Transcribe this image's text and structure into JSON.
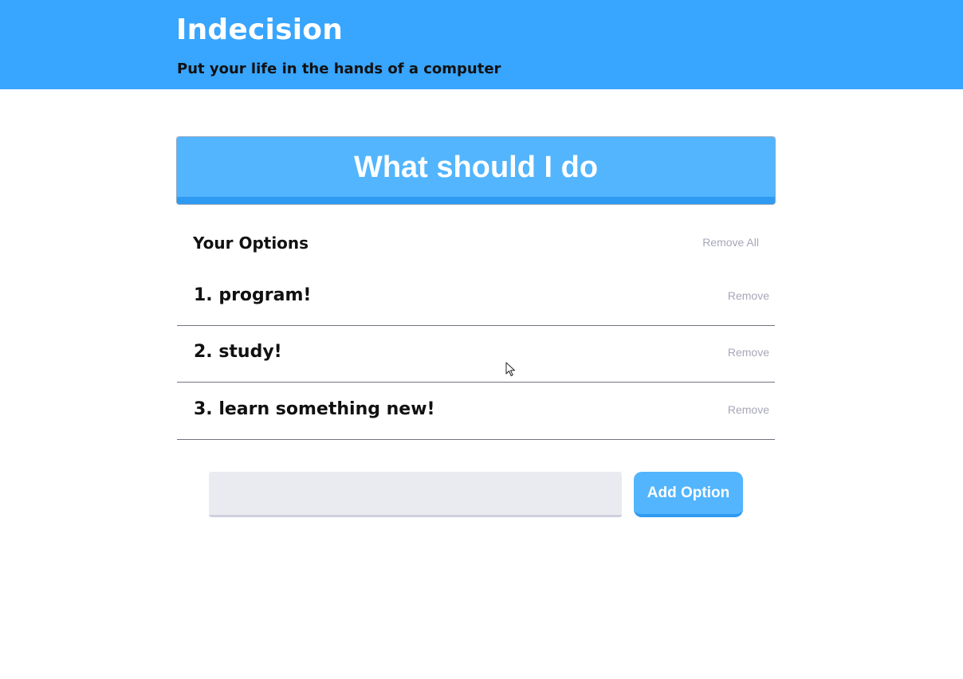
{
  "header": {
    "title": "Indecision",
    "subtitle": "Put your life in the hands of a computer"
  },
  "action": {
    "label": "What should I do"
  },
  "options": {
    "heading": "Your Options",
    "remove_all_label": "Remove All",
    "items": [
      {
        "text": "1. program!",
        "remove_label": "Remove"
      },
      {
        "text": "2. study!",
        "remove_label": "Remove"
      },
      {
        "text": "3. learn something new!",
        "remove_label": "Remove"
      }
    ]
  },
  "add_form": {
    "input_value": "",
    "input_placeholder": "",
    "button_label": "Add Option"
  },
  "colors": {
    "header_bg": "#38a5fe",
    "button_bg": "#52b5fe",
    "button_shadow": "#2f9af2",
    "muted_text": "#a7a7b8",
    "input_bg": "#eaebf1"
  },
  "icons": {
    "cursor": "mouse-pointer-icon"
  }
}
